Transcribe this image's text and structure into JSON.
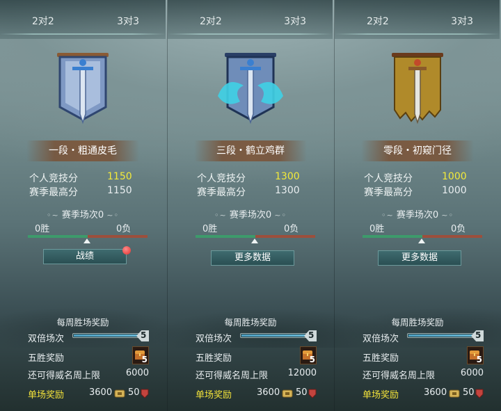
{
  "panels": [
    {
      "tabs": {
        "left": "2对2",
        "right": "3对3"
      },
      "emblem": "blue-banner-sword-icon",
      "rank": "一段・粗通皮毛",
      "score_label": "个人竞技分",
      "score": "1150",
      "best_label": "赛季最高分",
      "best": "1150",
      "season_title": "赛季场次0",
      "wins": "0胜",
      "losses": "0负",
      "button": "战绩",
      "has_alert": true,
      "weekly_title": "每周胜场奖励",
      "double_label": "双倍场次",
      "double_count": "5",
      "five_win_label": "五胜奖励",
      "five_win_count": "5",
      "cap_label": "还可得威名周上限",
      "cap_value": "6000",
      "single_label": "单场奖励",
      "single_coins": "3600",
      "single_honor": "50"
    },
    {
      "tabs": {
        "left": "2对2",
        "right": "3对3"
      },
      "emblem": "crane-banner-sword-icon",
      "rank": "三段・鹤立鸡群",
      "score_label": "个人竞技分",
      "score": "1300",
      "best_label": "赛季最高分",
      "best": "1300",
      "season_title": "赛季场次0",
      "wins": "0胜",
      "losses": "0负",
      "button": "更多数据",
      "has_alert": false,
      "weekly_title": "每周胜场奖励",
      "double_label": "双倍场次",
      "double_count": "5",
      "five_win_label": "五胜奖励",
      "five_win_count": "5",
      "cap_label": "还可得威名周上限",
      "cap_value": "12000",
      "single_label": "单场奖励",
      "single_coins": "3600",
      "single_honor": "50"
    },
    {
      "tabs": {
        "left": "2对2",
        "right": "3对3"
      },
      "emblem": "tattered-gold-banner-sword-icon",
      "rank": "零段・初窥门径",
      "score_label": "个人竞技分",
      "score": "1000",
      "best_label": "赛季最高分",
      "best": "1000",
      "season_title": "赛季场次0",
      "wins": "0胜",
      "losses": "0负",
      "button": "更多数据",
      "has_alert": false,
      "weekly_title": "每周胜场奖励",
      "double_label": "双倍场次",
      "double_count": "5",
      "five_win_label": "五胜奖励",
      "five_win_count": "5",
      "cap_label": "还可得威名周上限",
      "cap_value": "6000",
      "single_label": "单场奖励",
      "single_coins": "3600",
      "single_honor": "50"
    }
  ],
  "colors": {
    "score_highlight": "#f3ea3a",
    "reward_label": "#f2e23a",
    "win_bar": "#3d9a6b",
    "loss_bar": "#9c4f3c",
    "alert_dot": "#e0312d"
  }
}
